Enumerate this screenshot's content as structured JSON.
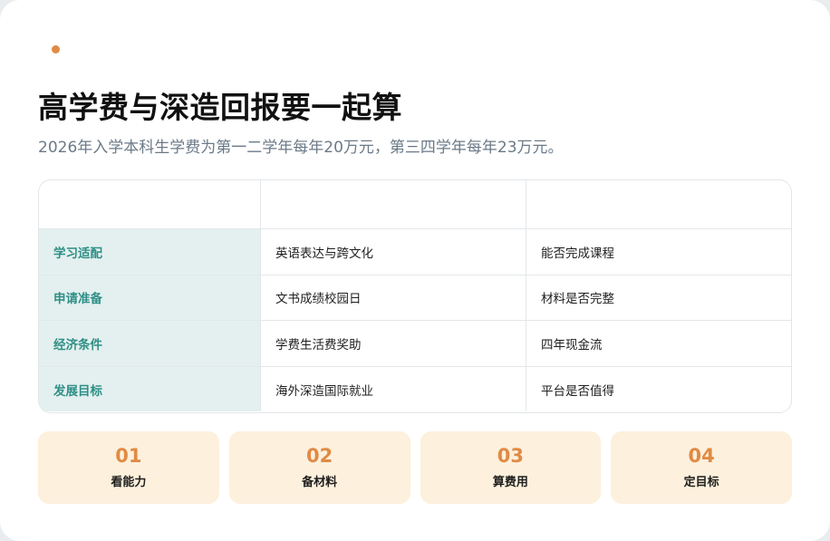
{
  "colors": {
    "accent": "#e08a45",
    "teal": "#2f8f86",
    "teal_bg": "#e3f0ef",
    "step_bg": "#fdf0dc"
  },
  "header": {
    "title": "高学费与深造回报要一起算",
    "subtitle": "2026年入学本科生学费为第一二学年每年20万元，第三四学年每年23万元。"
  },
  "table": {
    "headers": [
      "",
      "",
      ""
    ],
    "rows": [
      [
        "学习适配",
        "英语表达与跨文化",
        "能否完成课程"
      ],
      [
        "申请准备",
        "文书成绩校园日",
        "材料是否完整"
      ],
      [
        "经济条件",
        "学费生活费奖助",
        "四年现金流"
      ],
      [
        "发展目标",
        "海外深造国际就业",
        "平台是否值得"
      ]
    ]
  },
  "steps": [
    {
      "num": "01",
      "label": "看能力"
    },
    {
      "num": "02",
      "label": "备材料"
    },
    {
      "num": "03",
      "label": "算费用"
    },
    {
      "num": "04",
      "label": "定目标"
    }
  ]
}
